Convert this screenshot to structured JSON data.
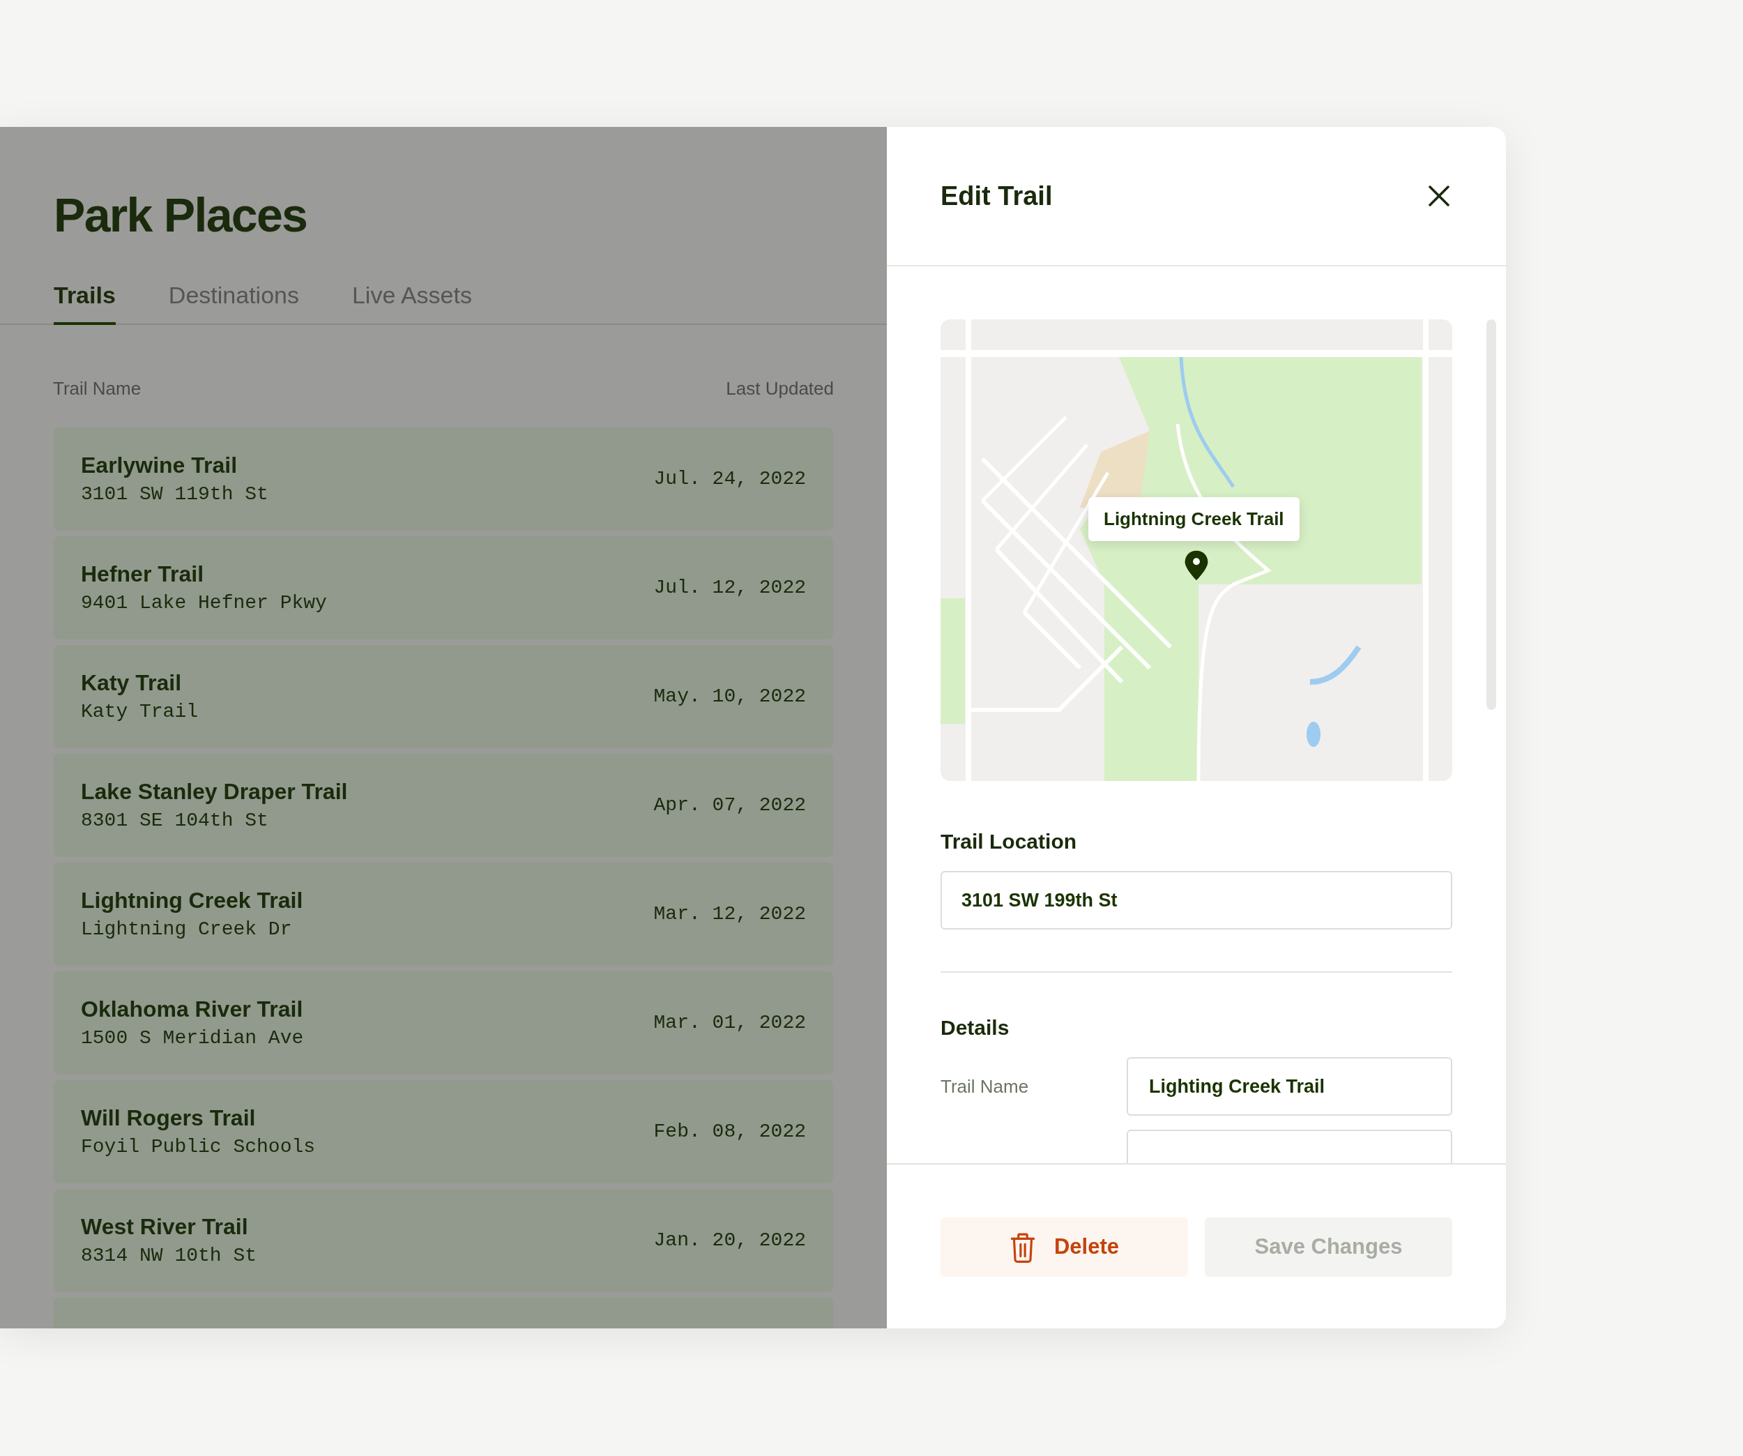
{
  "app": {
    "title": "Park Places"
  },
  "tabs": [
    {
      "label": "Trails",
      "selected": true
    },
    {
      "label": "Destinations",
      "selected": false
    },
    {
      "label": "Live Assets",
      "selected": false
    }
  ],
  "table": {
    "columns": [
      "Trail Name",
      "Last Updated"
    ],
    "rows": [
      {
        "name": "Earlywine Trail",
        "address": "3101 SW 119th St",
        "updated": "Jul. 24, 2022"
      },
      {
        "name": "Hefner Trail",
        "address": "9401 Lake Hefner Pkwy",
        "updated": "Jul. 12, 2022"
      },
      {
        "name": "Katy Trail",
        "address": "Katy Trail",
        "updated": "May. 10, 2022"
      },
      {
        "name": "Lake Stanley Draper Trail",
        "address": "8301 SE 104th St",
        "updated": "Apr. 07, 2022"
      },
      {
        "name": "Lightning Creek Trail",
        "address": "Lightning Creek Dr",
        "updated": "Mar. 12, 2022"
      },
      {
        "name": "Oklahoma River Trail",
        "address": "1500 S Meridian Ave",
        "updated": "Mar. 01, 2022"
      },
      {
        "name": "Will Rogers Trail",
        "address": "Foyil Public Schools",
        "updated": "Feb. 08, 2022"
      },
      {
        "name": "West River Trail",
        "address": "8314 NW 10th St",
        "updated": "Jan. 20, 2022"
      }
    ]
  },
  "panel": {
    "title": "Edit Trail",
    "map": {
      "kind": "picture",
      "callout": "Lightning Creek Trail"
    },
    "location": {
      "label": "Trail Location",
      "value": "3101 SW 199th St"
    },
    "details": {
      "title": "Details",
      "fields": [
        {
          "label": "Trail Name",
          "value": "Lighting Creek Trail"
        }
      ]
    },
    "buttons": [
      {
        "kind": "danger",
        "label": "Delete",
        "disabled": false
      },
      {
        "kind": "primary",
        "label": "Save Changes",
        "disabled": true
      }
    ]
  }
}
